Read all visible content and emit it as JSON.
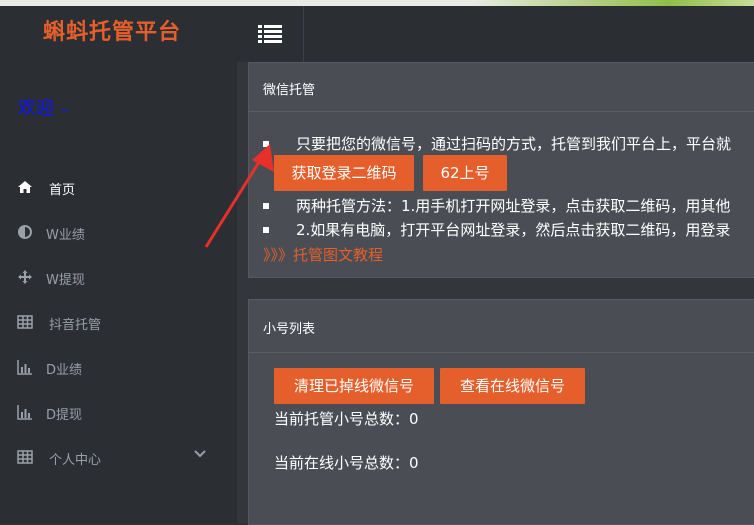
{
  "app": {
    "title": "蝌蚪托管平台"
  },
  "sidebar": {
    "welcome": "欢迎",
    "welcome_caret": "~",
    "items": [
      {
        "label": "首页",
        "icon": "home-icon",
        "active": true
      },
      {
        "label": "W业绩",
        "icon": "half-circle-icon"
      },
      {
        "label": "W提现",
        "icon": "move-arrows-icon"
      },
      {
        "label": "抖音托管",
        "icon": "table-icon"
      },
      {
        "label": "D业绩",
        "icon": "bar-chart-icon"
      },
      {
        "label": "D提现",
        "icon": "bar-chart-icon"
      },
      {
        "label": "个人中心",
        "icon": "table-icon",
        "expandable": true
      }
    ]
  },
  "topbar": {
    "toggle_icon": "list-icon"
  },
  "wechat_panel": {
    "title": "微信托管",
    "line1": "只要把您的微信号，通过扫码的方式，托管到我们平台上，平台就",
    "btn_qr": "获取登录二维码",
    "btn_62": "62上号",
    "line2": "两种托管方法：1.用手机打开网址登录，点击获取二维码，用其他",
    "line3": "2.如果有电脑，打开平台网址登录，然后点击获取二维码，用登录",
    "tutorial_link": "》》》托管图文教程"
  },
  "accounts_panel": {
    "title": "小号列表",
    "btn_clear": "清理已掉线微信号",
    "btn_view": "查看在线微信号",
    "total_hosted": "当前托管小号总数：0",
    "total_online": "当前在线小号总数：0"
  },
  "colors": {
    "accent": "#e45f2b",
    "sidebar_bg": "#2b2e33",
    "panel_bg": "#4a4e54",
    "welcome": "#0a14ff",
    "annotation_arrow": "#e8302a"
  }
}
